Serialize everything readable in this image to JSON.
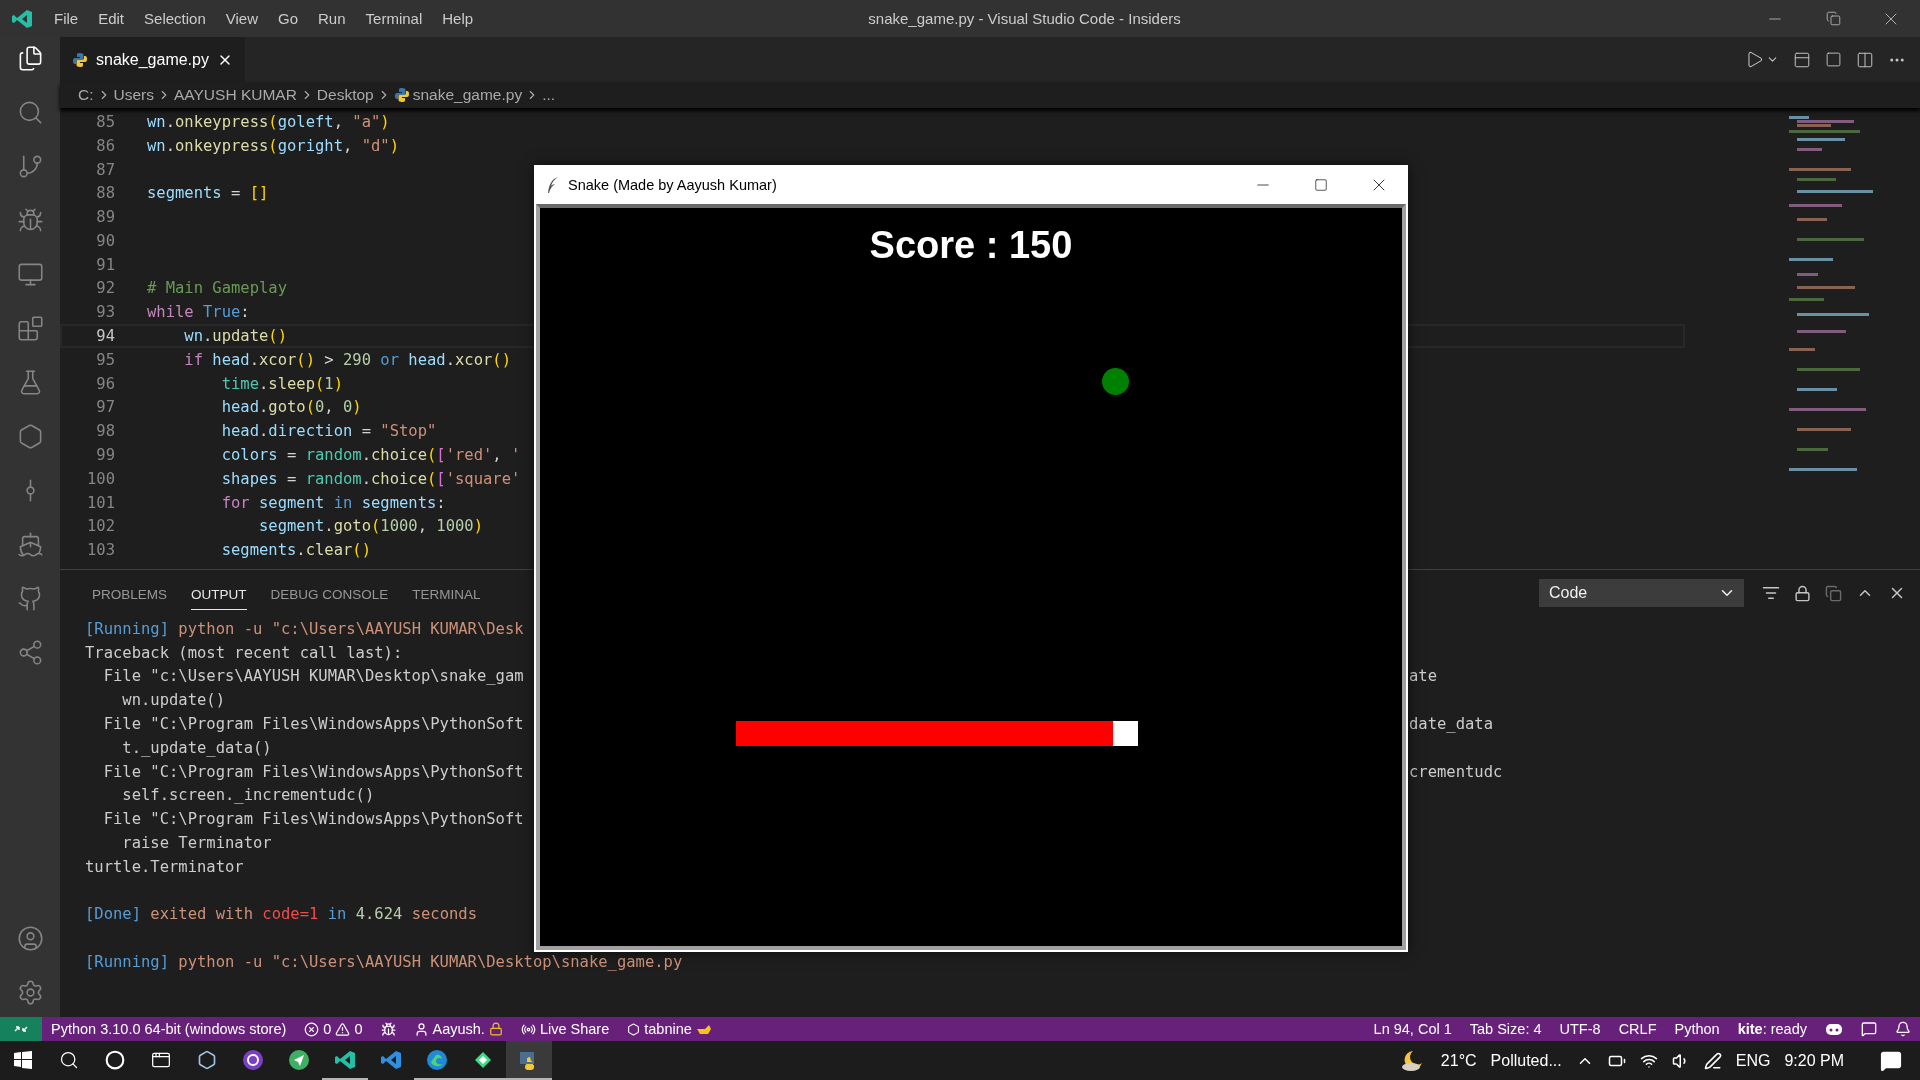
{
  "window": {
    "title": "snake_game.py - Visual Studio Code - Insiders"
  },
  "menu": [
    "File",
    "Edit",
    "Selection",
    "View",
    "Go",
    "Run",
    "Terminal",
    "Help"
  ],
  "editor_tab": {
    "label": "snake_game.py"
  },
  "breadcrumb": [
    "C:",
    "Users",
    "AAYUSH KUMAR",
    "Desktop",
    "snake_game.py",
    "..."
  ],
  "code_lines": [
    {
      "number": "85",
      "current": false,
      "tokens": [
        {
          "kind": "var",
          "text": "wn"
        },
        {
          "kind": "punct",
          "text": "."
        },
        {
          "kind": "func",
          "text": "onkeypress"
        },
        {
          "kind": "bracket",
          "text": "("
        },
        {
          "kind": "var",
          "text": "goleft"
        },
        {
          "kind": "punct",
          "text": ", "
        },
        {
          "kind": "string",
          "text": "\"a\""
        },
        {
          "kind": "bracket",
          "text": ")"
        }
      ]
    },
    {
      "number": "86",
      "current": false,
      "tokens": [
        {
          "kind": "var",
          "text": "wn"
        },
        {
          "kind": "punct",
          "text": "."
        },
        {
          "kind": "func",
          "text": "onkeypress"
        },
        {
          "kind": "bracket",
          "text": "("
        },
        {
          "kind": "var",
          "text": "goright"
        },
        {
          "kind": "punct",
          "text": ", "
        },
        {
          "kind": "string",
          "text": "\"d\""
        },
        {
          "kind": "bracket",
          "text": ")"
        }
      ]
    },
    {
      "number": "87",
      "current": false
    },
    {
      "number": "88",
      "current": false,
      "tokens": [
        {
          "kind": "var",
          "text": "segments"
        },
        {
          "kind": "punct",
          "text": " = "
        },
        {
          "kind": "bracket",
          "text": "[]"
        }
      ]
    },
    {
      "number": "89",
      "current": false
    },
    {
      "number": "90",
      "current": false
    },
    {
      "number": "91",
      "current": false
    },
    {
      "number": "92",
      "current": false,
      "tokens": [
        {
          "kind": "comment",
          "text": "# Main Gameplay"
        }
      ]
    },
    {
      "number": "93",
      "current": false,
      "tokens": [
        {
          "kind": "keyword",
          "text": "while"
        },
        {
          "kind": "const",
          "text": " True"
        },
        {
          "kind": "punct",
          "text": ":"
        }
      ]
    },
    {
      "number": "94",
      "current": true,
      "tokens": [
        {
          "kind": "var",
          "text": "    wn"
        },
        {
          "kind": "punct",
          "text": "."
        },
        {
          "kind": "func",
          "text": "update"
        },
        {
          "kind": "bracket",
          "text": "()"
        }
      ]
    },
    {
      "number": "95",
      "current": false,
      "tokens": [
        {
          "kind": "keyword",
          "text": "    if"
        },
        {
          "kind": "var",
          "text": " head"
        },
        {
          "kind": "punct",
          "text": "."
        },
        {
          "kind": "func",
          "text": "xcor"
        },
        {
          "kind": "bracket",
          "text": "()"
        },
        {
          "kind": "punct",
          "text": " > "
        },
        {
          "kind": "number",
          "text": "290"
        },
        {
          "kind": "const",
          "text": " or"
        },
        {
          "kind": "var",
          "text": " head"
        },
        {
          "kind": "punct",
          "text": "."
        },
        {
          "kind": "func",
          "text": "xcor"
        },
        {
          "kind": "bracket",
          "text": "()"
        }
      ]
    },
    {
      "number": "96",
      "current": false,
      "tokens": [
        {
          "kind": "module",
          "text": "        time"
        },
        {
          "kind": "punct",
          "text": "."
        },
        {
          "kind": "func",
          "text": "sleep"
        },
        {
          "kind": "bracket",
          "text": "("
        },
        {
          "kind": "number",
          "text": "1"
        },
        {
          "kind": "bracket",
          "text": ")"
        }
      ]
    },
    {
      "number": "97",
      "current": false,
      "tokens": [
        {
          "kind": "var",
          "text": "        head"
        },
        {
          "kind": "punct",
          "text": "."
        },
        {
          "kind": "func",
          "text": "goto"
        },
        {
          "kind": "bracket",
          "text": "("
        },
        {
          "kind": "number",
          "text": "0"
        },
        {
          "kind": "punct",
          "text": ", "
        },
        {
          "kind": "number",
          "text": "0"
        },
        {
          "kind": "bracket",
          "text": ")"
        }
      ]
    },
    {
      "number": "98",
      "current": false,
      "tokens": [
        {
          "kind": "var",
          "text": "        head"
        },
        {
          "kind": "punct",
          "text": "."
        },
        {
          "kind": "var",
          "text": "direction"
        },
        {
          "kind": "punct",
          "text": " = "
        },
        {
          "kind": "string",
          "text": "\"Stop\""
        }
      ]
    },
    {
      "number": "99",
      "current": false,
      "tokens": [
        {
          "kind": "var",
          "text": "        colors"
        },
        {
          "kind": "punct",
          "text": " = "
        },
        {
          "kind": "module",
          "text": "random"
        },
        {
          "kind": "punct",
          "text": "."
        },
        {
          "kind": "func",
          "text": "choice"
        },
        {
          "kind": "bracket",
          "text": "("
        },
        {
          "kind": "bracket2",
          "text": "["
        },
        {
          "kind": "string",
          "text": "'red'"
        },
        {
          "kind": "punct",
          "text": ", "
        },
        {
          "kind": "string",
          "text": "'"
        }
      ]
    },
    {
      "number": "100",
      "current": false,
      "tokens": [
        {
          "kind": "var",
          "text": "        shapes"
        },
        {
          "kind": "punct",
          "text": " = "
        },
        {
          "kind": "module",
          "text": "random"
        },
        {
          "kind": "punct",
          "text": "."
        },
        {
          "kind": "func",
          "text": "choice"
        },
        {
          "kind": "bracket",
          "text": "("
        },
        {
          "kind": "bracket2",
          "text": "["
        },
        {
          "kind": "string",
          "text": "'square'"
        }
      ]
    },
    {
      "number": "101",
      "current": false,
      "tokens": [
        {
          "kind": "keyword",
          "text": "        for"
        },
        {
          "kind": "var",
          "text": " segment"
        },
        {
          "kind": "const",
          "text": " in"
        },
        {
          "kind": "var",
          "text": " segments"
        },
        {
          "kind": "punct",
          "text": ":"
        }
      ]
    },
    {
      "number": "102",
      "current": false,
      "tokens": [
        {
          "kind": "var",
          "text": "            segment"
        },
        {
          "kind": "punct",
          "text": "."
        },
        {
          "kind": "func",
          "text": "goto"
        },
        {
          "kind": "bracket",
          "text": "("
        },
        {
          "kind": "number",
          "text": "1000"
        },
        {
          "kind": "punct",
          "text": ", "
        },
        {
          "kind": "number",
          "text": "1000"
        },
        {
          "kind": "bracket",
          "text": ")"
        }
      ]
    },
    {
      "number": "103",
      "current": false,
      "tokens": [
        {
          "kind": "var",
          "text": "        segments"
        },
        {
          "kind": "punct",
          "text": "."
        },
        {
          "kind": "func",
          "text": "clear"
        },
        {
          "kind": "bracket",
          "text": "()"
        }
      ]
    }
  ],
  "panel": {
    "tabs": [
      {
        "label": "PROBLEMS",
        "selected": false
      },
      {
        "label": "OUTPUT",
        "selected": true
      },
      {
        "label": "DEBUG CONSOLE",
        "selected": false
      },
      {
        "label": "TERMINAL",
        "selected": false
      }
    ],
    "channel": "Code",
    "output_blocks": [
      [
        {
          "tokens": [
            {
              "kind": "tag",
              "text": "[Running]"
            },
            {
              "kind": "cmd",
              "text": " python -u \"c:\\Users\\AAYUSH KUMAR\\Desk"
            }
          ]
        },
        {
          "tokens": [
            {
              "kind": "plain",
              "text": "Traceback (most recent call last):"
            }
          ]
        },
        {
          "tokens": [
            {
              "kind": "plain",
              "text": "  File \"c:\\Users\\AAYUSH KUMAR\\Desktop\\snake_gam"
            }
          ],
          "tail": "ate"
        },
        {
          "tokens": [
            {
              "kind": "plain",
              "text": "    wn.update()"
            }
          ]
        },
        {
          "tokens": [
            {
              "kind": "plain",
              "text": "  File \"C:\\Program Files\\WindowsApps\\PythonSoft"
            }
          ],
          "tail": "date_data"
        },
        {
          "tokens": [
            {
              "kind": "plain",
              "text": "    t._update_data()"
            }
          ]
        },
        {
          "tokens": [
            {
              "kind": "plain",
              "text": "  File \"C:\\Program Files\\WindowsApps\\PythonSoft"
            }
          ],
          "tail": "crementudc"
        },
        {
          "tokens": [
            {
              "kind": "plain",
              "text": "    self.screen._incrementudc()"
            }
          ]
        },
        {
          "tokens": [
            {
              "kind": "plain",
              "text": "  File \"C:\\Program Files\\WindowsApps\\PythonSoft"
            }
          ]
        },
        {
          "tokens": [
            {
              "kind": "plain",
              "text": "    raise Terminator"
            }
          ]
        },
        {
          "tokens": [
            {
              "kind": "plain",
              "text": "turtle.Terminator"
            }
          ]
        }
      ],
      [
        {
          "tokens": [
            {
              "kind": "tag",
              "text": "[Done]"
            },
            {
              "kind": "cmd",
              "text": " exited with "
            },
            {
              "kind": "error",
              "text": "code=1"
            },
            {
              "kind": "tag",
              "text": " in "
            },
            {
              "kind": "num",
              "text": "4.624"
            },
            {
              "kind": "cmd",
              "text": " seconds"
            }
          ]
        }
      ],
      [
        {
          "tokens": [
            {
              "kind": "tag",
              "text": "[Running]"
            },
            {
              "kind": "cmd",
              "text": " python -u \"c:\\Users\\AAYUSH KUMAR\\Desktop\\snake_game.py"
            }
          ]
        }
      ]
    ]
  },
  "game_window": {
    "title": "Snake (Made by Aayush Kumar)",
    "score": "Score : 150"
  },
  "status_bar": {
    "interpreter": "Python 3.10.0 64-bit (windows store)",
    "errors": "0",
    "warnings": "0",
    "account": "Aayush.",
    "live_share": "Live Share",
    "tabnine": "tabnine",
    "right": [
      "Ln 94, Col 1",
      "Tab Size: 4",
      "UTF-8",
      "CRLF",
      "Python",
      "**kite**: ready"
    ]
  },
  "taskbar": {
    "apps": [
      {
        "kind": "cube",
        "running": false,
        "selected": false
      },
      {
        "kind": "github",
        "running": false,
        "selected": false
      },
      {
        "kind": "send",
        "running": false,
        "selected": false
      },
      {
        "kind": "code-insiders",
        "running": true,
        "selected": false
      },
      {
        "kind": "code",
        "running": false,
        "selected": false
      },
      {
        "kind": "edge",
        "running": true,
        "selected": false
      },
      {
        "kind": "kite",
        "running": true,
        "selected": false
      },
      {
        "kind": "python",
        "running": true,
        "selected": true
      }
    ],
    "weather": "21°C",
    "weather_text": "Polluted...",
    "language": "ENG",
    "time": "9:20 PM"
  }
}
